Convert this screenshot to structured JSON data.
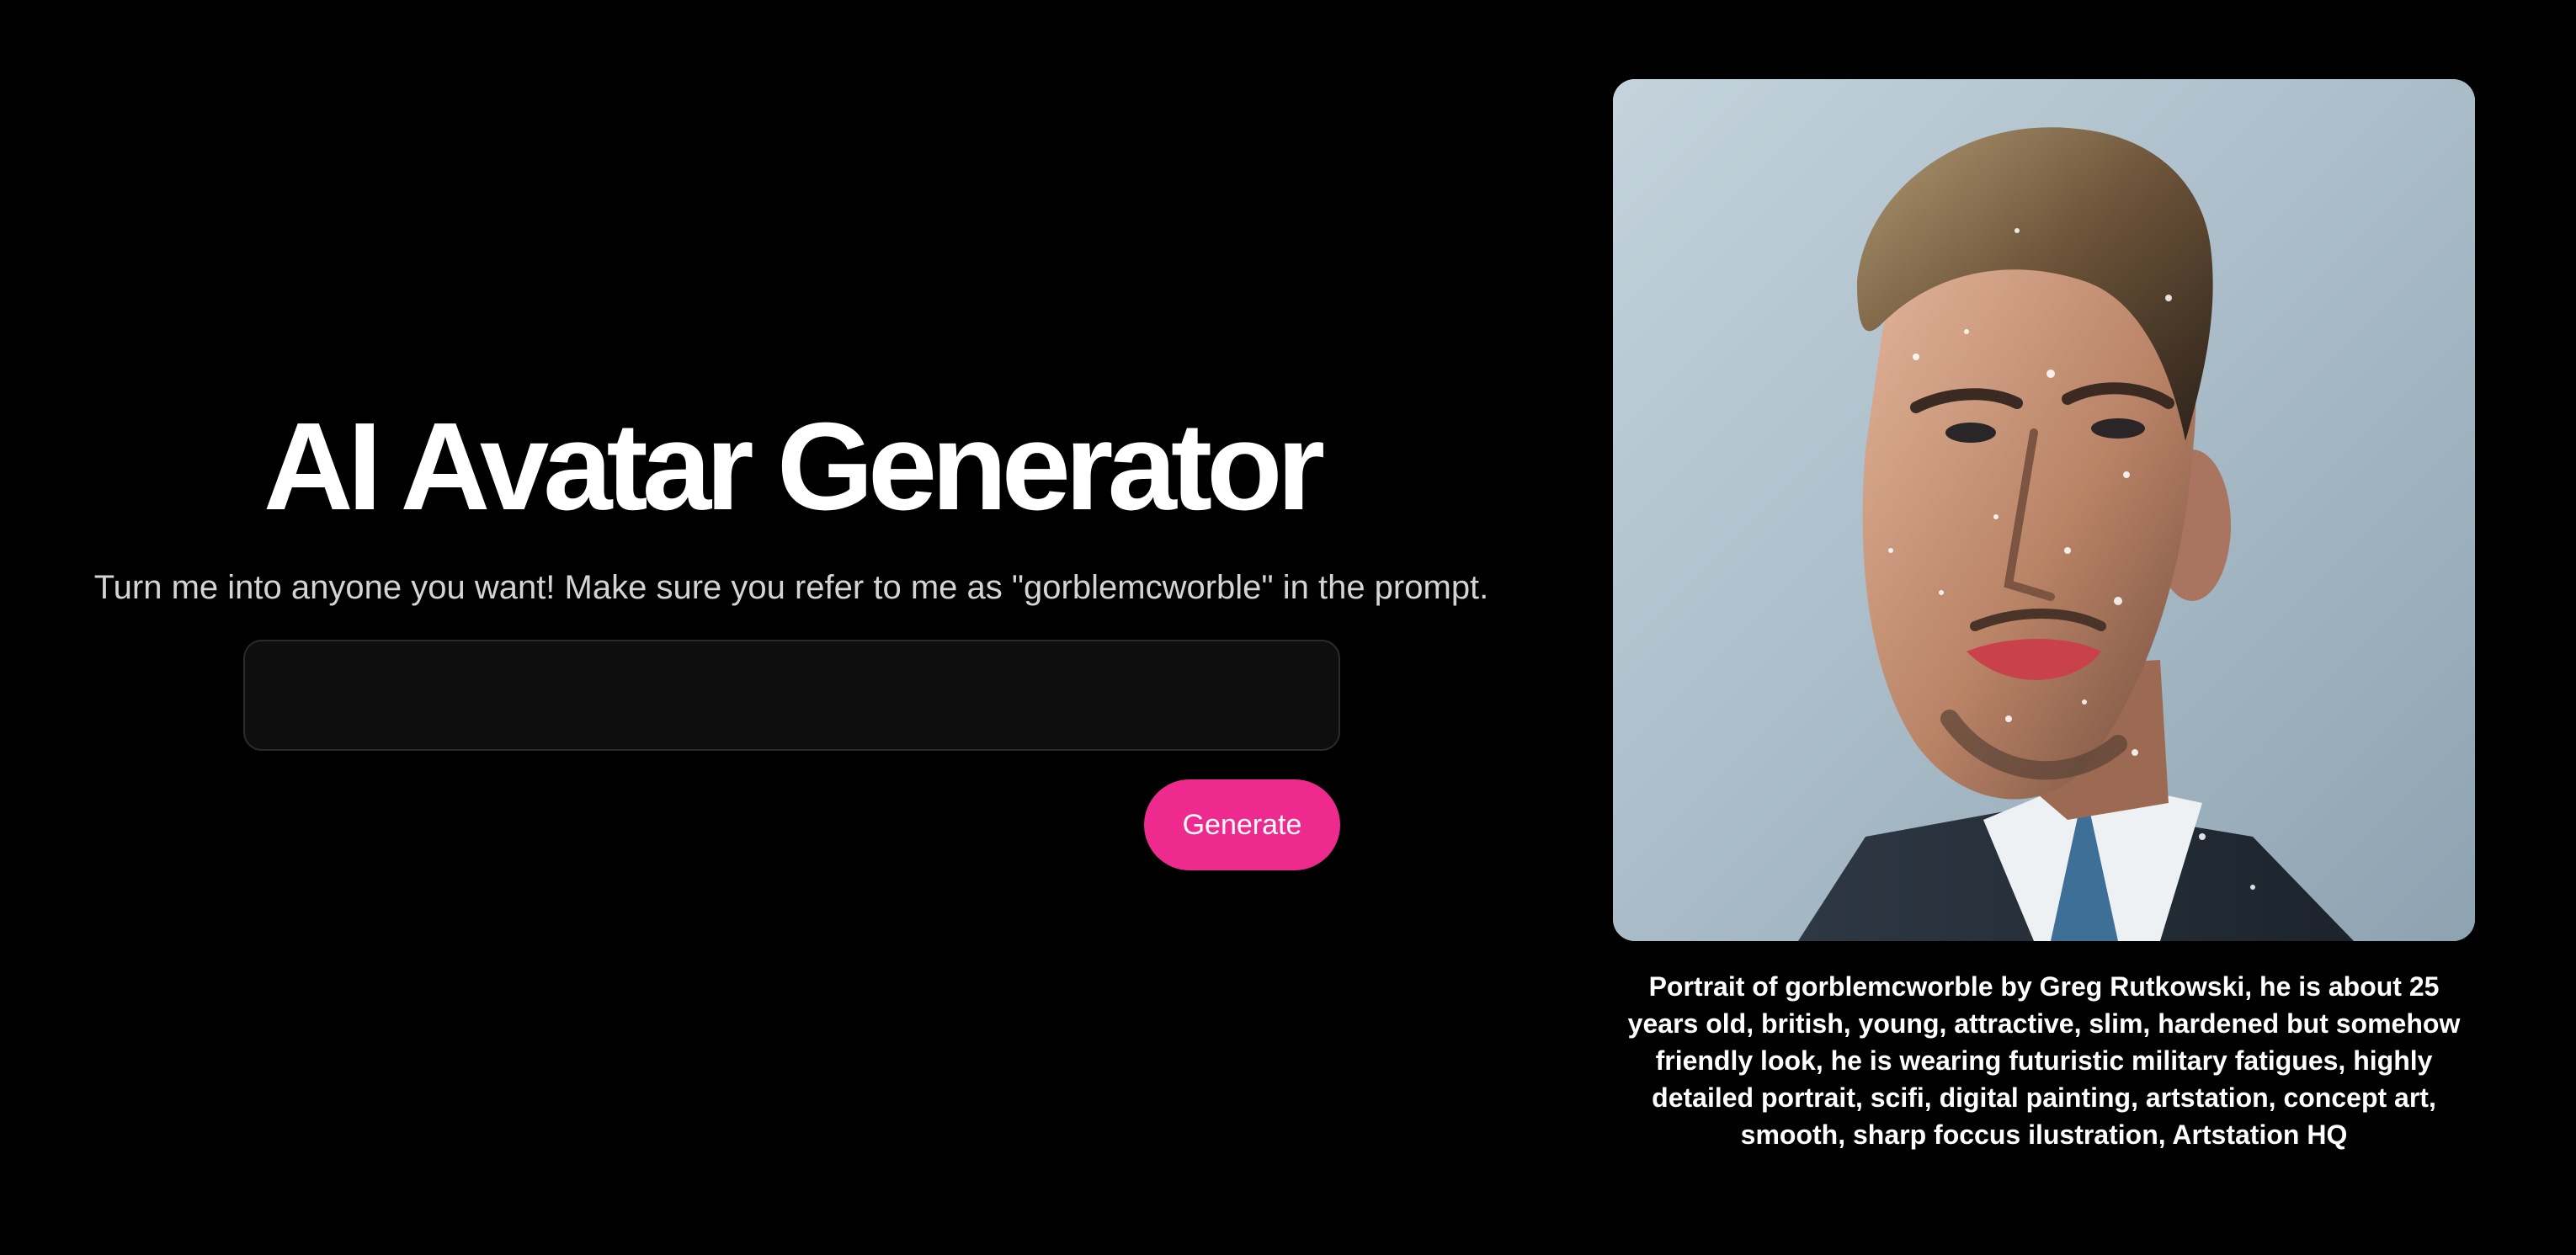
{
  "hero": {
    "title": "AI Avatar Generator",
    "subtitle": "Turn me into anyone you want! Make sure you refer to me as \"gorblemcworble\" in the prompt."
  },
  "form": {
    "prompt_value": "",
    "prompt_placeholder": "",
    "generate_label": "Generate"
  },
  "result": {
    "image_icon": "generated-avatar-portrait",
    "caption": "Portrait of gorblemcworble by Greg Rutkowski, he is about 25 years old, british, young, attractive, slim, hardened but somehow friendly look, he is wearing futuristic military fatigues, highly detailed portrait, scifi, digital painting, artstation, concept art, smooth, sharp foccus ilustration, Artstation HQ"
  },
  "colors": {
    "background": "#000000",
    "accent": "#ee2a8f",
    "input_background": "#0e0e0e",
    "input_border": "#2b2b2b",
    "subtitle_text": "#d4d4d4"
  }
}
